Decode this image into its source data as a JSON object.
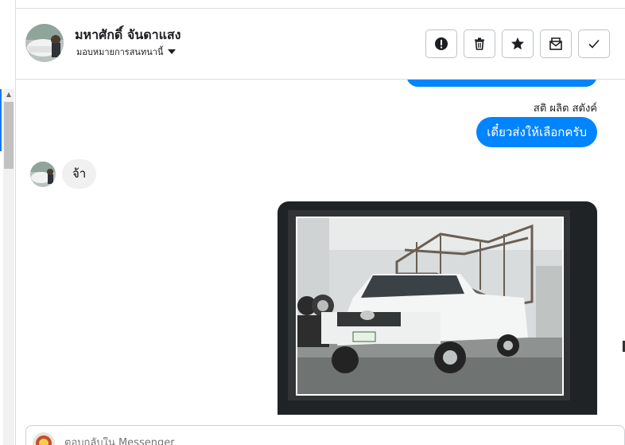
{
  "header": {
    "contact_name": "มหาศักดิ์ จันดาแสง",
    "assign_label": "มอบหมายการสนทนานี้",
    "actions": [
      {
        "name": "report-button",
        "icon": "exclamation-icon"
      },
      {
        "name": "delete-button",
        "icon": "trash-icon"
      },
      {
        "name": "star-button",
        "icon": "star-icon"
      },
      {
        "name": "mark-unread-button",
        "icon": "envelope-icon"
      },
      {
        "name": "done-button",
        "icon": "check-icon"
      }
    ]
  },
  "conversation": {
    "sender_label": "สติ ผลิต สตังค์",
    "outgoing_message": "เดี๋ยวส่งให้เลือกครับ",
    "incoming_message": "จ้า",
    "image_alt": "Toyota Hilux"
  },
  "composer": {
    "placeholder": "ตอบกลับใน Messenger"
  },
  "colors": {
    "accent": "#0084ff",
    "incoming_bubble": "#f0f0f0",
    "border": "#bec3c9"
  }
}
